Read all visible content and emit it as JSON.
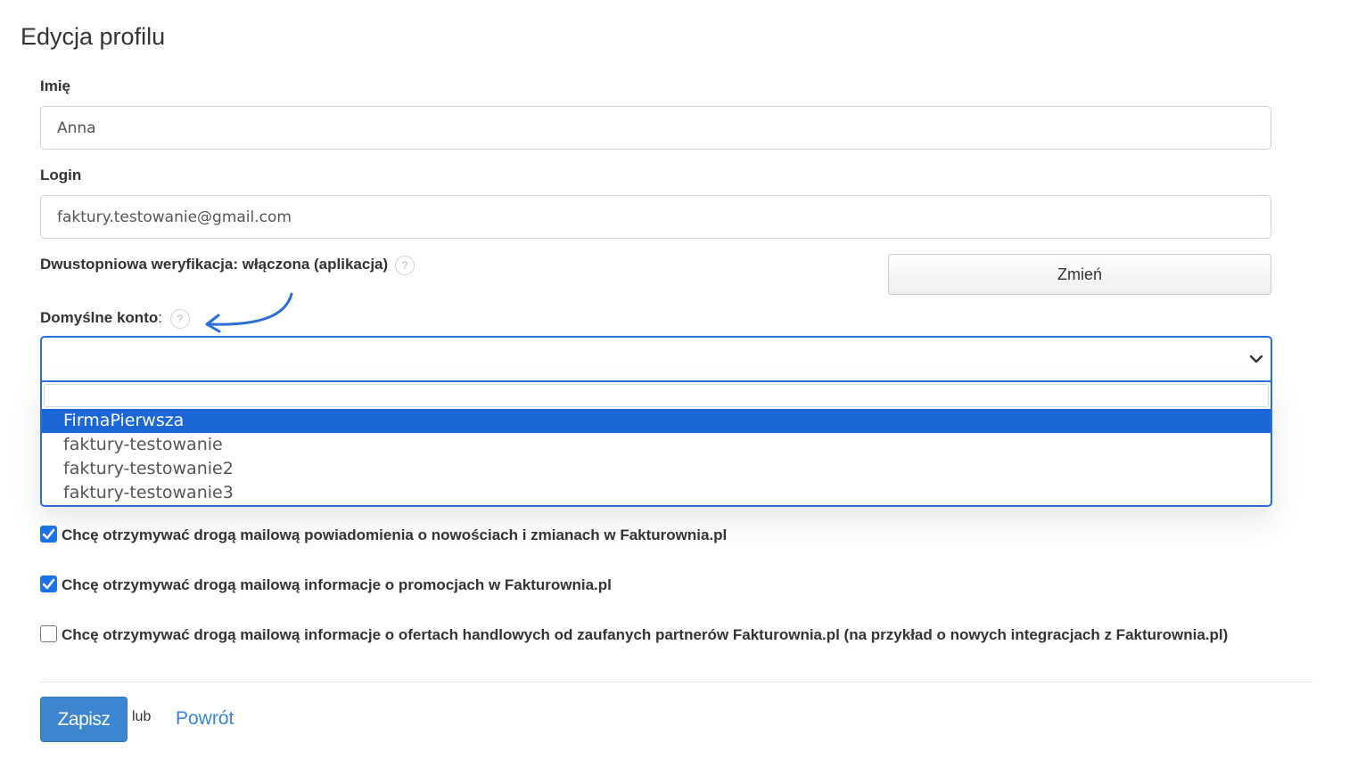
{
  "page": {
    "title": "Edycja profilu"
  },
  "form": {
    "name": {
      "label": "Imię",
      "value": "Anna"
    },
    "login": {
      "label": "Login",
      "value": "faktury.testowanie@gmail.com"
    },
    "two_factor": {
      "label": "Dwustopniowa weryfikacja: włączona (aplikacja)",
      "help": "?",
      "change_button": "Zmień"
    },
    "default_account": {
      "label": "Domyślne konto",
      "label_suffix": ":",
      "help": "?",
      "selected_value": "",
      "options": [
        "FirmaPierwsza",
        "faktury-testowanie",
        "faktury-testowanie2",
        "faktury-testowanie3"
      ],
      "highlighted_index": 0
    },
    "checkboxes": [
      {
        "label": "Chcę otrzymywać drogą mailową powiadomienia o nowościach i zmianach w Fakturownia.pl",
        "checked": true
      },
      {
        "label": "Chcę otrzymywać drogą mailową informacje o promocjach w Fakturownia.pl",
        "checked": true
      },
      {
        "label": "Chcę otrzymywać drogą mailową informacje o ofertach handlowych od zaufanych partnerów Fakturownia.pl (na przykład o nowych integracjach z Fakturownia.pl)",
        "checked": false
      }
    ]
  },
  "actions": {
    "save": "Zapisz",
    "or": "lub",
    "back": "Powrót"
  },
  "colors": {
    "accent": "#3b86cf",
    "focus": "#2a6fd8",
    "highlight": "#1c67d8",
    "arrow": "#2a6fd8"
  },
  "icons": {
    "help": "question-circle-icon",
    "select_arrow": "chevron-down-icon",
    "annotation": "curved-arrow-icon"
  }
}
